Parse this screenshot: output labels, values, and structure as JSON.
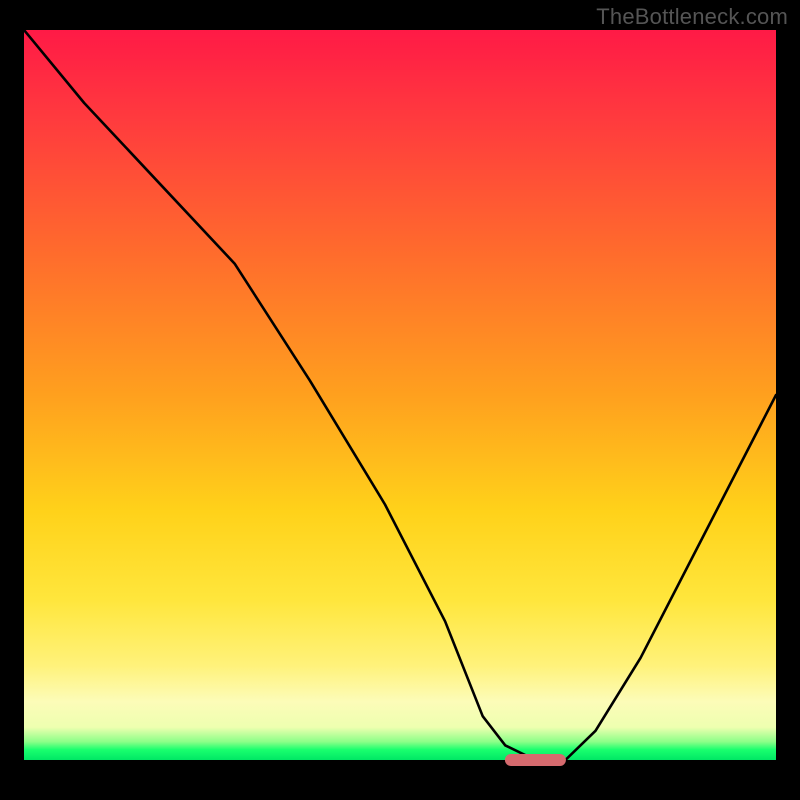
{
  "watermark": "TheBottleneck.com",
  "marker_color": "#d56a6e",
  "chart_data": {
    "type": "line",
    "title": "",
    "xlabel": "",
    "ylabel": "",
    "xlim": [
      0,
      100
    ],
    "ylim": [
      0,
      100
    ],
    "series": [
      {
        "name": "bottleneck-curve",
        "x": [
          0,
          8,
          18,
          28,
          38,
          48,
          56,
          61,
          64,
          68,
          72,
          76,
          82,
          90,
          100
        ],
        "y": [
          100,
          90,
          79,
          68,
          52,
          35,
          19,
          6,
          2,
          0,
          0,
          4,
          14,
          30,
          50
        ]
      }
    ],
    "minimum_region": {
      "x_start": 64,
      "x_end": 72,
      "y": 0
    },
    "background_gradient": {
      "orientation": "vertical",
      "stops": [
        {
          "pos": 0.0,
          "color": "#ff1a46"
        },
        {
          "pos": 0.5,
          "color": "#ffa01e"
        },
        {
          "pos": 0.78,
          "color": "#ffe63c"
        },
        {
          "pos": 0.96,
          "color": "#eeffb0"
        },
        {
          "pos": 1.0,
          "color": "#00e765"
        }
      ]
    }
  }
}
